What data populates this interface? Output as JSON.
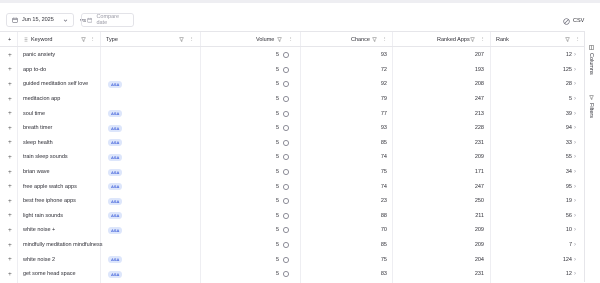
{
  "toolbar": {
    "date": "Jun 15, 2025",
    "vs": "VS",
    "compare_placeholder": "Compare date",
    "csv": "CSV"
  },
  "columns": {
    "keyword": "Keyword",
    "type": "Type",
    "volume": "Volume",
    "chance": "Chance",
    "ranked_apps": "Ranked Apps",
    "rank": "Rank"
  },
  "sidebar": {
    "columns": "Columns",
    "filters": "Filters"
  },
  "rows": [
    {
      "keyword": "panic anxiety",
      "type": "",
      "volume": "5",
      "chance": "93",
      "ranked": "207",
      "rank": "12"
    },
    {
      "keyword": "app to-do",
      "type": "",
      "volume": "5",
      "chance": "72",
      "ranked": "193",
      "rank": "125"
    },
    {
      "keyword": "guided meditation self love",
      "type": "ASA",
      "volume": "5",
      "chance": "92",
      "ranked": "208",
      "rank": "28"
    },
    {
      "keyword": "meditacion app",
      "type": "",
      "volume": "5",
      "chance": "79",
      "ranked": "247",
      "rank": "5"
    },
    {
      "keyword": "soul time",
      "type": "ASA",
      "volume": "5",
      "chance": "77",
      "ranked": "213",
      "rank": "39"
    },
    {
      "keyword": "breath timer",
      "type": "ASA",
      "volume": "5",
      "chance": "93",
      "ranked": "228",
      "rank": "94"
    },
    {
      "keyword": "sleep health",
      "type": "ASA",
      "volume": "5",
      "chance": "85",
      "ranked": "231",
      "rank": "33"
    },
    {
      "keyword": "train sleep sounds",
      "type": "ASA",
      "volume": "5",
      "chance": "74",
      "ranked": "209",
      "rank": "55"
    },
    {
      "keyword": "brian wave",
      "type": "ASA",
      "volume": "5",
      "chance": "75",
      "ranked": "171",
      "rank": "34"
    },
    {
      "keyword": "free apple watch apps",
      "type": "ASA",
      "volume": "5",
      "chance": "74",
      "ranked": "247",
      "rank": "95"
    },
    {
      "keyword": "best free iphone apps",
      "type": "ASA",
      "volume": "5",
      "chance": "23",
      "ranked": "250",
      "rank": "19"
    },
    {
      "keyword": "light rain sounds",
      "type": "ASA",
      "volume": "5",
      "chance": "88",
      "ranked": "211",
      "rank": "56"
    },
    {
      "keyword": "white noise +",
      "type": "ASA",
      "volume": "5",
      "chance": "70",
      "ranked": "209",
      "rank": "10"
    },
    {
      "keyword": "mindfully meditation mindfulness",
      "type": "",
      "volume": "5",
      "chance": "85",
      "ranked": "209",
      "rank": "7"
    },
    {
      "keyword": "white noise 2",
      "type": "ASA",
      "volume": "5",
      "chance": "75",
      "ranked": "204",
      "rank": "124"
    },
    {
      "keyword": "get some head space",
      "type": "ASA",
      "volume": "5",
      "chance": "83",
      "ranked": "231",
      "rank": "12"
    }
  ]
}
